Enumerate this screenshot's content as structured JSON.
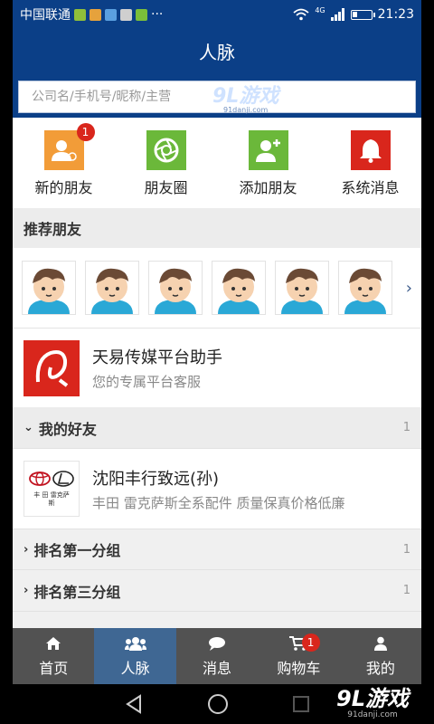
{
  "status_bar": {
    "carrier": "中国联通",
    "dots": "···",
    "network": "4G",
    "time": "21:23"
  },
  "header": {
    "title": "人脉",
    "search_placeholder": "公司名/手机号/昵称/主营"
  },
  "quick_actions": [
    {
      "label": "新的朋友",
      "icon": "new-friend-icon",
      "color": "#f29c38",
      "badge": "1"
    },
    {
      "label": "朋友圈",
      "icon": "moments-icon",
      "color": "#6bb83a"
    },
    {
      "label": "添加朋友",
      "icon": "add-friend-icon",
      "color": "#6bb83a"
    },
    {
      "label": "系统消息",
      "icon": "bell-icon",
      "color": "#d9261c"
    }
  ],
  "recommend": {
    "title": "推荐朋友",
    "count": 6
  },
  "assistant": {
    "name": "天易传媒平台助手",
    "subtitle": "您的专属平台客服"
  },
  "my_friends": {
    "title": "我的好友",
    "count": "1"
  },
  "friends": [
    {
      "name": "沈阳丰行致远(孙)",
      "desc": "丰田 雷克萨斯全系配件 质量保真价格低廉",
      "logo_text": "丰 田 雷克萨斯"
    }
  ],
  "groups": [
    {
      "title": "排名第一分组",
      "count": "1"
    },
    {
      "title": "排名第三分组",
      "count": "1"
    }
  ],
  "tabs": [
    {
      "label": "首页",
      "icon": "home-icon"
    },
    {
      "label": "人脉",
      "icon": "contacts-icon",
      "active": true
    },
    {
      "label": "消息",
      "icon": "message-icon"
    },
    {
      "label": "购物车",
      "icon": "cart-icon",
      "badge": "1"
    },
    {
      "label": "我的",
      "icon": "profile-icon"
    }
  ],
  "watermark": {
    "brand": "9L游戏",
    "url": "91danji.com"
  },
  "colors": {
    "header": "#0b3f87",
    "active_tab": "#3f6793",
    "tabbar": "#525252",
    "badge": "#d9261c"
  }
}
